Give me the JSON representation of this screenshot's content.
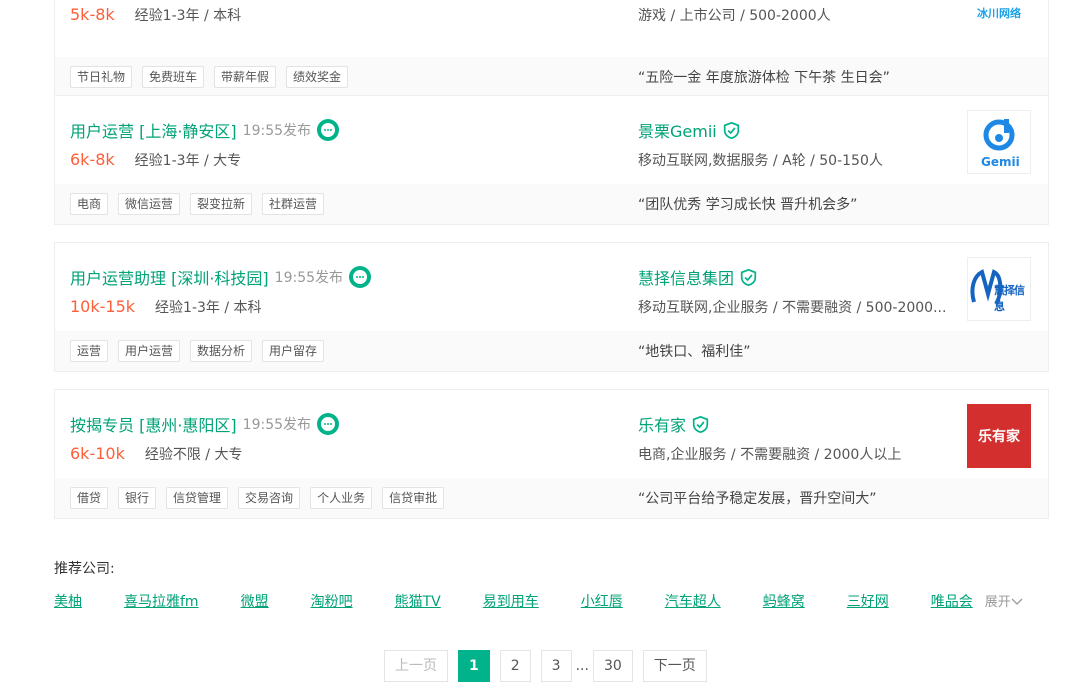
{
  "jobs": [
    {
      "title": "",
      "time": "",
      "salary": "5k-8k",
      "req": "经验1-3年 / 本科",
      "company": "",
      "industry": "游戏 / 上市公司 / 500-2000人",
      "logo_text": "冰川网络",
      "logo_color": "#1aa3e8",
      "tags": [
        "节日礼物",
        "免费班车",
        "带薪年假",
        "绩效奖金"
      ],
      "benefit": "“五险一金 年度旅游体检 下午茶 生日会”"
    },
    {
      "title": "用户运营 [上海·静安区]",
      "time": "19:55发布",
      "salary": "6k-8k",
      "req": "经验1-3年 / 大专",
      "company": "景栗Gemii",
      "industry": "移动互联网,数据服务 / A轮 / 50-150人",
      "logo_text": "Gemii",
      "logo_color": "#1e88e5",
      "tags": [
        "电商",
        "微信运营",
        "裂变拉新",
        "社群运营"
      ],
      "benefit": "“团队优秀 学习成长快 晋升机会多”"
    },
    {
      "title": "用户运营助理 [深圳·科技园]",
      "time": "19:55发布",
      "salary": "10k-15k",
      "req": "经验1-3年 / 本科",
      "company": "慧择信息集团",
      "industry": "移动互联网,企业服务 / 不需要融资 / 500-2000...",
      "logo_text": "慧择信息",
      "logo_color": "#1565c0",
      "tags": [
        "运营",
        "用户运营",
        "数据分析",
        "用户留存"
      ],
      "benefit": "“地铁口、福利佳”"
    },
    {
      "title": "按揭专员 [惠州·惠阳区]",
      "time": "19:55发布",
      "salary": "6k-10k",
      "req": "经验不限 / 大专",
      "company": "乐有家",
      "industry": "电商,企业服务 / 不需要融资 / 2000人以上",
      "logo_text": "乐有家",
      "logo_color": "#d32f2f",
      "tags": [
        "借贷",
        "银行",
        "信贷管理",
        "交易咨询",
        "个人业务",
        "信贷审批"
      ],
      "benefit": "“公司平台给予稳定发展，晋升空间大”"
    }
  ],
  "recommend": {
    "title": "推荐公司:",
    "companies": [
      "美柚",
      "喜马拉雅fm",
      "微盟",
      "淘粉吧",
      "熊猫TV",
      "易到用车",
      "小红唇",
      "汽车超人",
      "蚂蜂窝",
      "三好网",
      "唯品会"
    ],
    "expand": "展开"
  },
  "pager": {
    "prev": "上一页",
    "pages": [
      "1",
      "2",
      "3"
    ],
    "ellipsis": "...",
    "last": "30",
    "next": "下一页",
    "current": "1"
  },
  "colors": {
    "accent": "#00b38a",
    "salary": "#fd5f39"
  }
}
